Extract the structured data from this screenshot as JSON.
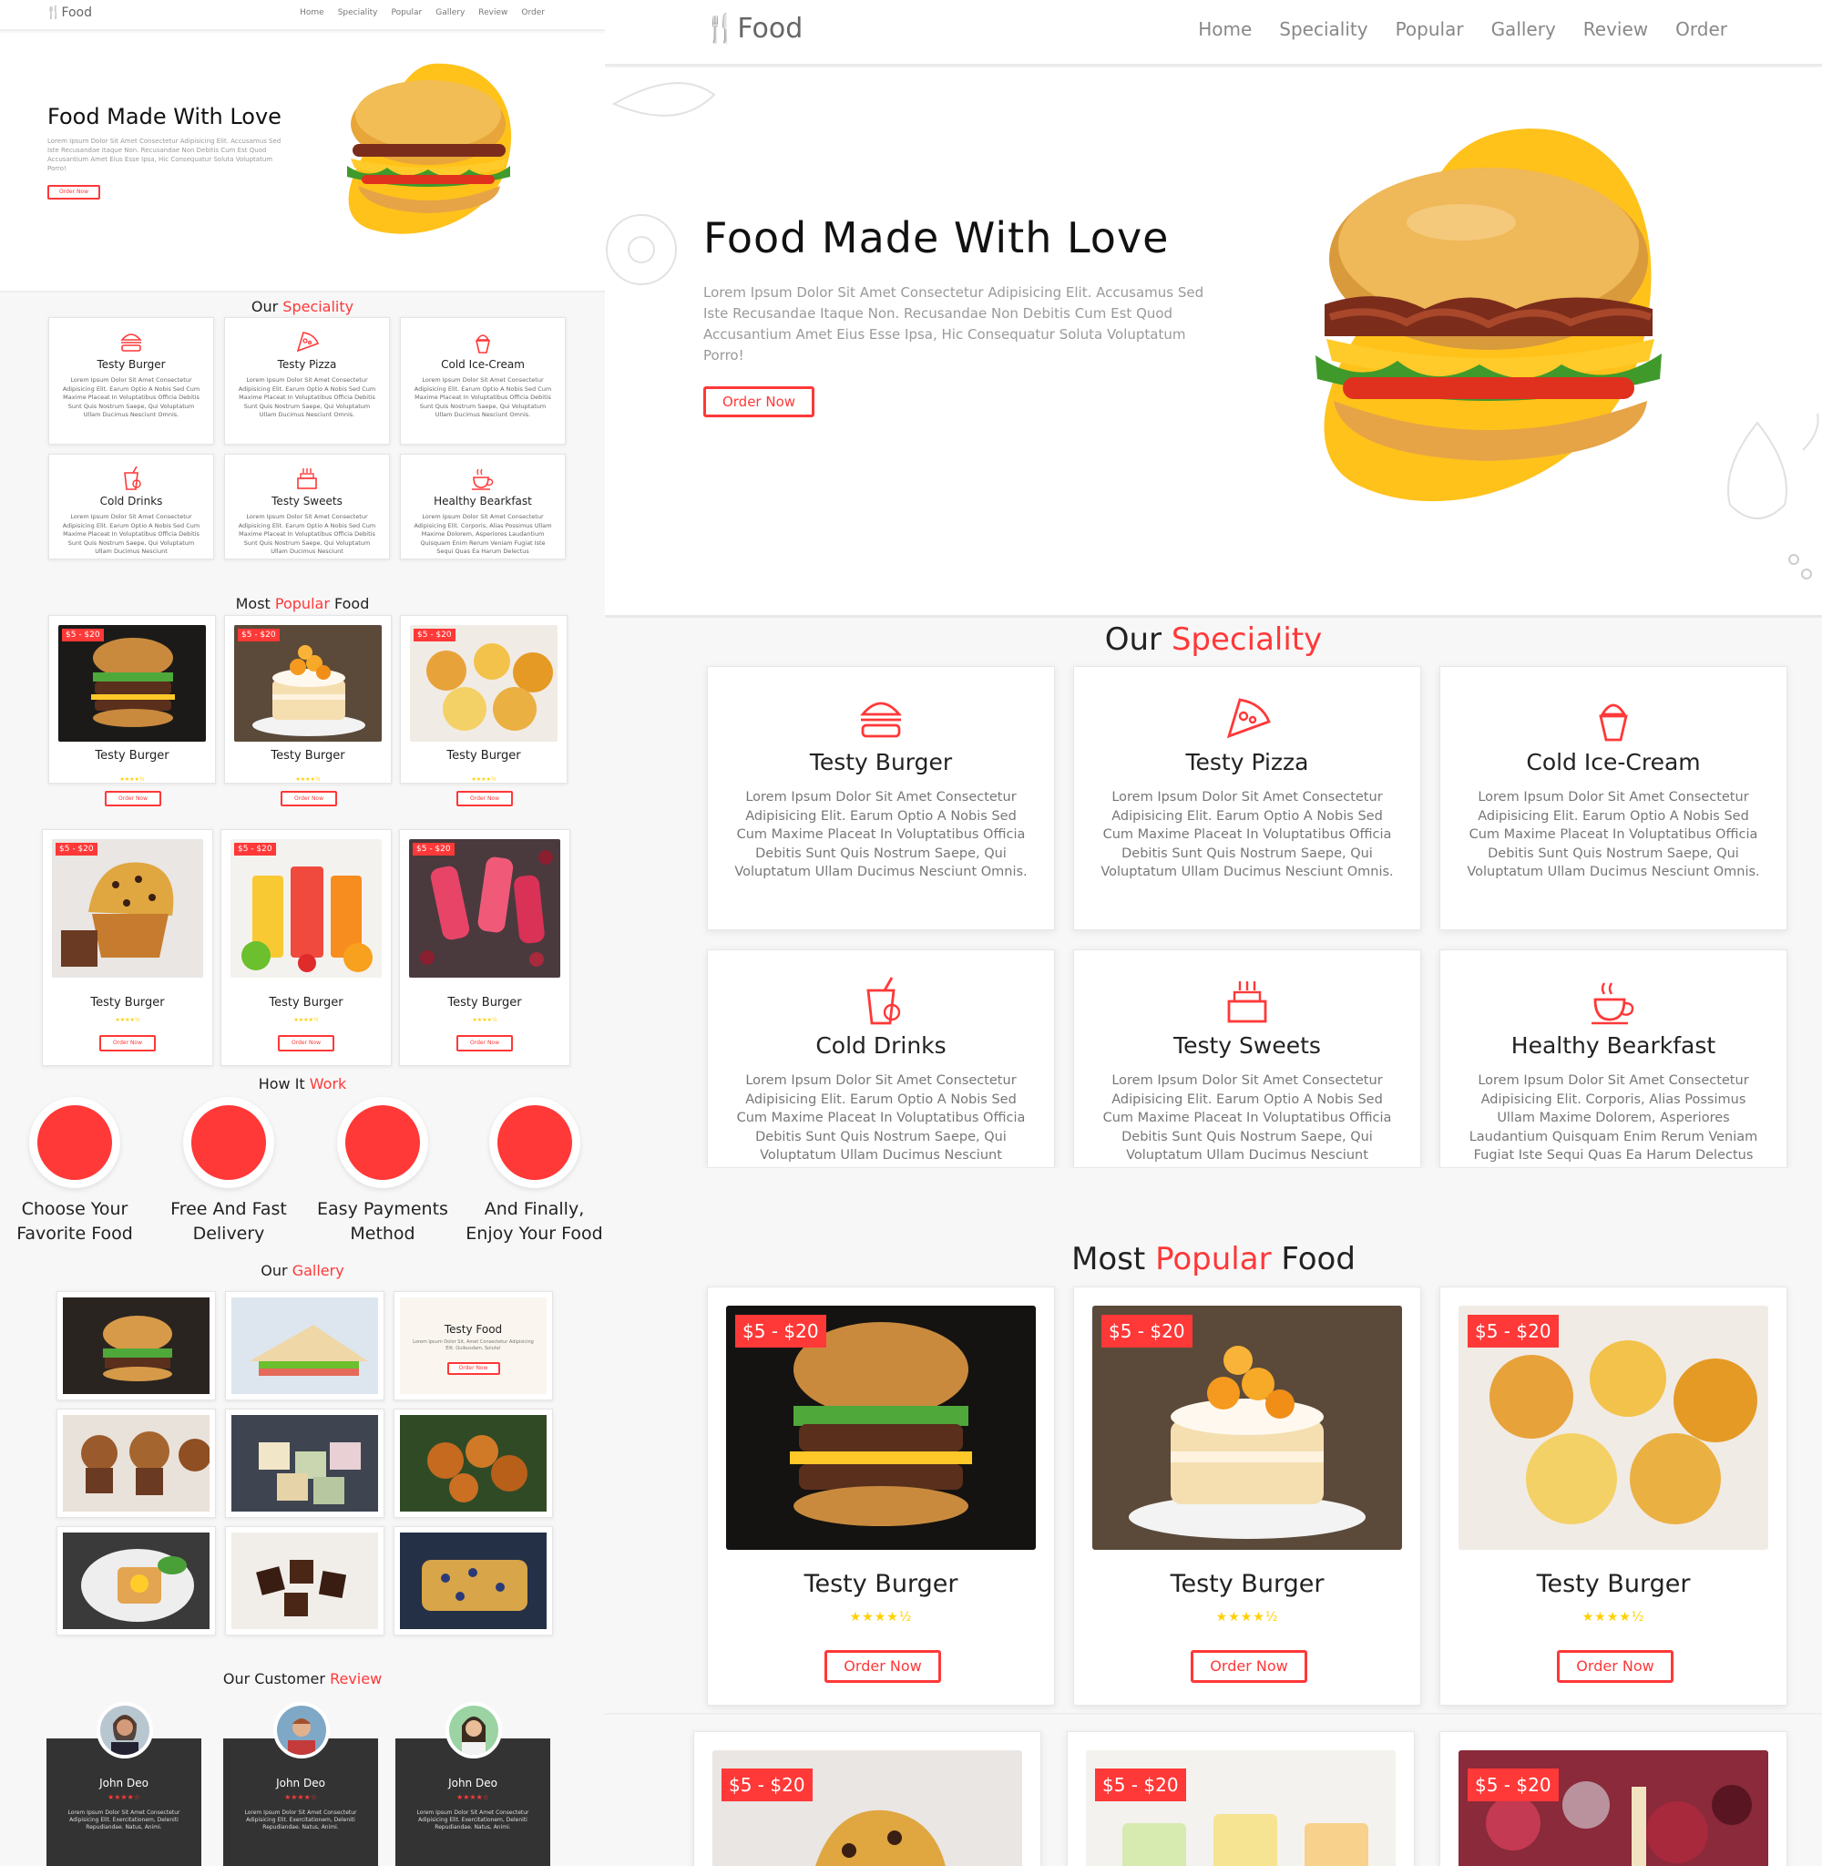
{
  "brand": {
    "name": "Food"
  },
  "nav": [
    "Home",
    "Speciality",
    "Popular",
    "Gallery",
    "Review",
    "Order"
  ],
  "hero": {
    "title": "Food Made With Love",
    "text": "Lorem Ipsum Dolor Sit Amet Consectetur Adipisicing Elit. Accusamus Sed Iste Recusandae Itaque Non. Recusandae Non Debitis Cum Est Quod Accusantium Amet Eius Esse Ipsa, Hic Consequatur Soluta Voluptatum Porro!",
    "button": "Order Now"
  },
  "speciality": {
    "title_a": "Our",
    "title_b": "Speciality",
    "items": [
      {
        "title": "Testy Burger",
        "icon": "burger-icon",
        "text": "Lorem Ipsum Dolor Sit Amet Consectetur Adipisicing Elit. Earum Optio A Nobis Sed Cum Maxime Placeat In Voluptatibus Officia Debitis Sunt Quis Nostrum Saepe, Qui Voluptatum Ullam Ducimus Nesciunt Omnis."
      },
      {
        "title": "Testy Pizza",
        "icon": "pizza-icon",
        "text": "Lorem Ipsum Dolor Sit Amet Consectetur Adipisicing Elit. Earum Optio A Nobis Sed Cum Maxime Placeat In Voluptatibus Officia Debitis Sunt Quis Nostrum Saepe, Qui Voluptatum Ullam Ducimus Nesciunt Omnis."
      },
      {
        "title": "Cold Ice-Cream",
        "icon": "ice-cream-icon",
        "text": "Lorem Ipsum Dolor Sit Amet Consectetur Adipisicing Elit. Earum Optio A Nobis Sed Cum Maxime Placeat In Voluptatibus Officia Debitis Sunt Quis Nostrum Saepe, Qui Voluptatum Ullam Ducimus Nesciunt Omnis."
      },
      {
        "title": "Cold Drinks",
        "icon": "drink-icon",
        "text": "Lorem Ipsum Dolor Sit Amet Consectetur Adipisicing Elit. Earum Optio A Nobis Sed Cum Maxime Placeat In Voluptatibus Officia Debitis Sunt Quis Nostrum Saepe, Qui Voluptatum Ullam Ducimus Nesciunt"
      },
      {
        "title": "Testy Sweets",
        "icon": "cake-icon",
        "text": "Lorem Ipsum Dolor Sit Amet Consectetur Adipisicing Elit. Earum Optio A Nobis Sed Cum Maxime Placeat In Voluptatibus Officia Debitis Sunt Quis Nostrum Saepe, Qui Voluptatum Ullam Ducimus Nesciunt"
      },
      {
        "title": "Healthy Bearkfast",
        "icon": "coffee-cup-icon",
        "text": "Lorem Ipsum Dolor Sit Amet Consectetur Adipisicing Elit. Corporis, Alias Possimus Ullam Maxime Dolorem, Asperiores Laudantium Quisquam Enim Rerum Veniam Fugiat Iste Sequi Quas Ea Harum Delectus"
      }
    ]
  },
  "popular": {
    "title_a": "Most",
    "title_b": "Popular",
    "title_c": "Food",
    "items": [
      {
        "price": "$5 - $20",
        "title": "Testy Burger",
        "stars": "★★★★½",
        "button": "Order Now",
        "image": "burger"
      },
      {
        "price": "$5 - $20",
        "title": "Testy Burger",
        "stars": "★★★★½",
        "button": "Order Now",
        "image": "cake"
      },
      {
        "price": "$5 - $20",
        "title": "Testy Burger",
        "stars": "★★★★½",
        "button": "Order Now",
        "image": "snacks"
      },
      {
        "price": "$5 - $20",
        "title": "Testy Burger",
        "stars": "★★★★½",
        "button": "Order Now",
        "image": "muffin"
      },
      {
        "price": "$5 - $20",
        "title": "Testy Burger",
        "stars": "★★★★½",
        "button": "Order Now",
        "image": "juice"
      },
      {
        "price": "$5 - $20",
        "title": "Testy Burger",
        "stars": "★★★★½",
        "button": "Order Now",
        "image": "popsicle"
      }
    ]
  },
  "work": {
    "title_a": "How It",
    "title_b": "Work",
    "steps": [
      {
        "line1": "Choose Your",
        "line2": "Favorite Food"
      },
      {
        "line1": "Free And Fast",
        "line2": "Delivery"
      },
      {
        "line1": "Easy Payments",
        "line2": "Method"
      },
      {
        "line1": "And Finally,",
        "line2": "Enjoy Your Food"
      }
    ]
  },
  "gallery": {
    "title_a": "Our",
    "title_b": "Gallery",
    "overlay_title": "Testy Food",
    "overlay_text": "Lorem Ipsum Dolor Sit, Amet Consectetur Adipisicing Elit. Quibusdam, Soluta!",
    "overlay_button": "Order Now"
  },
  "review": {
    "title_a": "Our Customer",
    "title_b": "Review",
    "items": [
      {
        "name": "John Deo",
        "stars": "★★★★☆",
        "text": "Lorem Ipsum Dolor Sit Amet Consectetur Adipisicing Elit. Exercitationem, Deleniti Repudiandae. Natus, Animi."
      },
      {
        "name": "John Deo",
        "stars": "★★★★☆",
        "text": "Lorem Ipsum Dolor Sit Amet Consectetur Adipisicing Elit. Exercitationem, Deleniti Repudiandae. Natus, Animi."
      },
      {
        "name": "John Deo",
        "stars": "★★★★☆",
        "text": "Lorem Ipsum Dolor Sit Amet Consectetur Adipisicing Elit. Exercitationem, Deleniti Repudiandae. Natus, Animi."
      }
    ]
  },
  "colors": {
    "accent": "#ff3838",
    "star": "#ffd000",
    "review_card": "#333333"
  }
}
